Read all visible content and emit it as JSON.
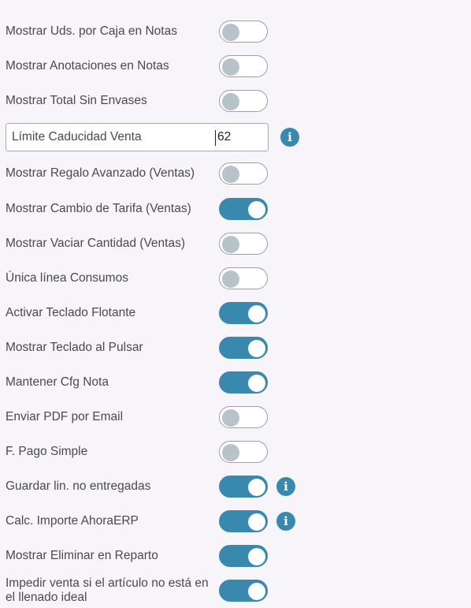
{
  "settings": [
    {
      "type": "toggle",
      "label": "Mostrar Uds. por Caja en Notas",
      "on": false,
      "info": false
    },
    {
      "type": "toggle",
      "label": "Mostrar Anotaciones en Notas",
      "on": false,
      "info": false
    },
    {
      "type": "toggle",
      "label": "Mostrar Total Sin Envases",
      "on": false,
      "info": false
    },
    {
      "type": "input",
      "label": "Límite Caducidad Venta",
      "value": "62",
      "info": true
    },
    {
      "type": "toggle",
      "label": "Mostrar Regalo Avanzado (Ventas)",
      "on": false,
      "info": false
    },
    {
      "type": "toggle",
      "label": "Mostrar Cambio de Tarifa (Ventas)",
      "on": true,
      "info": false
    },
    {
      "type": "toggle",
      "label": "Mostrar Vaciar Cantidad (Ventas)",
      "on": false,
      "info": false
    },
    {
      "type": "toggle",
      "label": "Única línea Consumos",
      "on": false,
      "info": false
    },
    {
      "type": "toggle",
      "label": "Activar Teclado Flotante",
      "on": true,
      "info": false
    },
    {
      "type": "toggle",
      "label": "Mostrar Teclado al Pulsar",
      "on": true,
      "info": false
    },
    {
      "type": "toggle",
      "label": "Mantener Cfg Nota",
      "on": true,
      "info": false
    },
    {
      "type": "toggle",
      "label": "Enviar PDF por Email",
      "on": false,
      "info": false
    },
    {
      "type": "toggle",
      "label": "F. Pago Simple",
      "on": false,
      "info": false
    },
    {
      "type": "toggle",
      "label": "Guardar lin. no entregadas",
      "on": true,
      "info": true
    },
    {
      "type": "toggle",
      "label": "Calc. Importe AhoraERP",
      "on": true,
      "info": true
    },
    {
      "type": "toggle",
      "label": "Mostrar Eliminar en Reparto",
      "on": true,
      "info": false
    },
    {
      "type": "toggle",
      "label": "Impedir venta si el artículo no está en el llenado ideal",
      "on": true,
      "info": false
    }
  ],
  "icons": {
    "info": "info-icon"
  },
  "colors": {
    "accent": "#3889ad",
    "knob_off": "#b8c2c9",
    "background": "#f7f4fa"
  },
  "info_glyph": "i"
}
